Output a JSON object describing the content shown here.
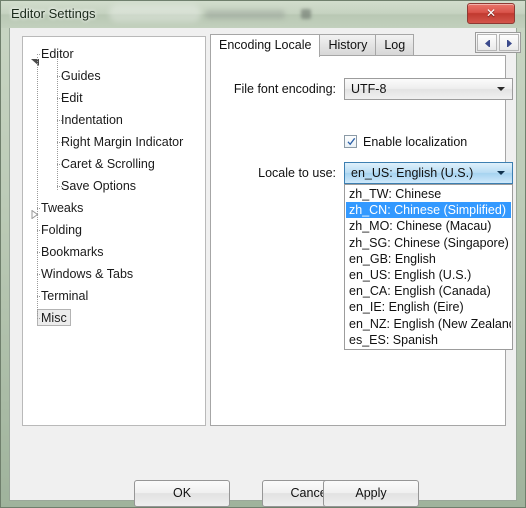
{
  "window": {
    "title": "Editor Settings",
    "close_label": "✕",
    "close_icon": "close-icon"
  },
  "tree": {
    "items": [
      {
        "label": "Editor",
        "level": 0,
        "expander": "open",
        "selected": false
      },
      {
        "label": "Guides",
        "level": 1,
        "expander": "none",
        "selected": false
      },
      {
        "label": "Edit",
        "level": 1,
        "expander": "none",
        "selected": false
      },
      {
        "label": "Indentation",
        "level": 1,
        "expander": "none",
        "selected": false
      },
      {
        "label": "Right Margin Indicator",
        "level": 1,
        "expander": "none",
        "selected": false
      },
      {
        "label": "Caret & Scrolling",
        "level": 1,
        "expander": "none",
        "selected": false
      },
      {
        "label": "Save Options",
        "level": 1,
        "expander": "none",
        "selected": false
      },
      {
        "label": "Tweaks",
        "level": 0,
        "expander": "closed",
        "selected": false
      },
      {
        "label": "Folding",
        "level": 0,
        "expander": "none",
        "selected": false
      },
      {
        "label": "Bookmarks",
        "level": 0,
        "expander": "none",
        "selected": false
      },
      {
        "label": "Windows & Tabs",
        "level": 0,
        "expander": "none",
        "selected": false
      },
      {
        "label": "Terminal",
        "level": 0,
        "expander": "none",
        "selected": false
      },
      {
        "label": "Misc",
        "level": 0,
        "expander": "none",
        "selected": true
      }
    ]
  },
  "tabs": {
    "items": [
      {
        "label": "Encoding  Locale",
        "active": true
      },
      {
        "label": "History",
        "active": false
      },
      {
        "label": "Log",
        "active": false
      }
    ],
    "nav_prev_icon": "arrow-left-icon",
    "nav_next_icon": "arrow-right-icon"
  },
  "form": {
    "encoding_label": "File font encoding:",
    "encoding_value": "UTF-8",
    "encoding_arrow_icon": "chevron-down-icon",
    "checkbox_label": "Enable localization",
    "checkbox_checked": true,
    "checkbox_icon": "checkmark-icon",
    "locale_label": "Locale to use:",
    "locale_value": "en_US: English (U.S.)",
    "locale_arrow_icon": "chevron-down-icon"
  },
  "dropdown": {
    "selected_index": 1,
    "options": [
      "zh_TW: Chinese",
      "zh_CN: Chinese (Simplified)",
      "zh_MO: Chinese (Macau)",
      "zh_SG: Chinese (Singapore)",
      "en_GB: English",
      "en_US: English (U.S.)",
      "en_CA: English (Canada)",
      "en_IE: English (Eire)",
      "en_NZ: English (New Zealand)",
      "es_ES: Spanish"
    ]
  },
  "buttons": {
    "ok": "OK",
    "cancel": "Cancel",
    "apply": "Apply"
  },
  "colors": {
    "selection_blue": "#3399ff",
    "close_red": "#c0392f",
    "titlebar_green": "#c6d3c1",
    "dialog_bg": "#f0f0f0",
    "panel_bg": "#ffffff"
  }
}
